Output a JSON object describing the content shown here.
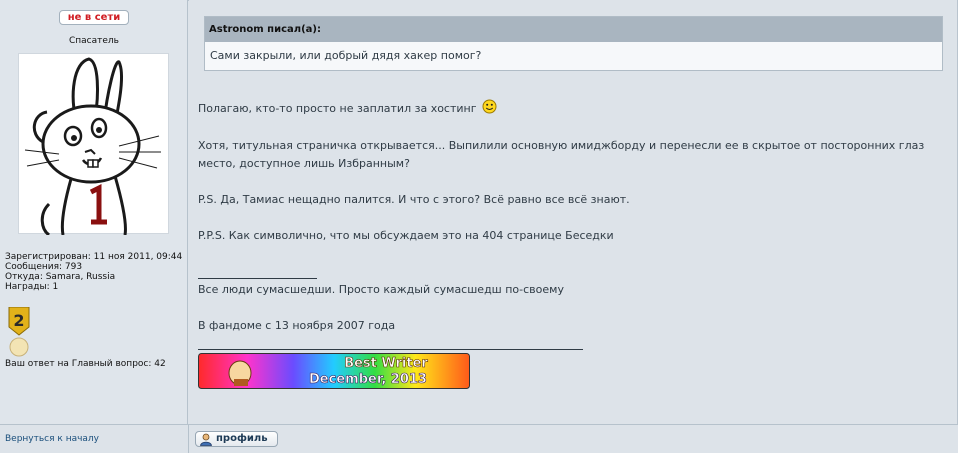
{
  "profile": {
    "status": "не в сети",
    "rank": "Спасатель",
    "registered": "Зарегистрирован: 11 ноя 2011, 09:44",
    "messages": "Сообщения: 793",
    "location": "Откуда: Samara, Russia",
    "awards": "Награды: 1",
    "medal_number": "2",
    "main_answer": "Ваш ответ на Главный вопрос: 42"
  },
  "post": {
    "quote_author": "Astronom писал(а):",
    "quote_text": "Сами закрыли, или добрый дядя хакер помог?",
    "p1": "Полагаю, кто-то просто не заплатил за хостинг",
    "p2_line1": "Хотя, титульная страничка открывается... Выпилили основную имиджборду и перенесли ее в скрытое от посторонних глаз",
    "p2_line2": "место, доступное лишь Избранным?",
    "p3": "P.S. Да, Тамиас нещадно палится. И что с этого? Всё равно все всё знают.",
    "p4": "P.P.S. Как символично, что мы обсуждаем это на 404 странице Беседки",
    "sig1": "Все люди сумасшедши. Просто каждый сумасшедш по-своему",
    "sig2": "В фандоме с 13 ноября 2007 года",
    "banner_line1": "Best Writer",
    "banner_line2": "December, 2013"
  },
  "footer": {
    "back_link": "Вернуться к началу",
    "profile_button": "профиль"
  },
  "colors": {
    "status_red": "#d01d23",
    "quote_header": "#a9b5c0",
    "background": "#dde3e9"
  },
  "icons": [
    "smiley-icon",
    "medal-icon",
    "profile-user-icon"
  ]
}
